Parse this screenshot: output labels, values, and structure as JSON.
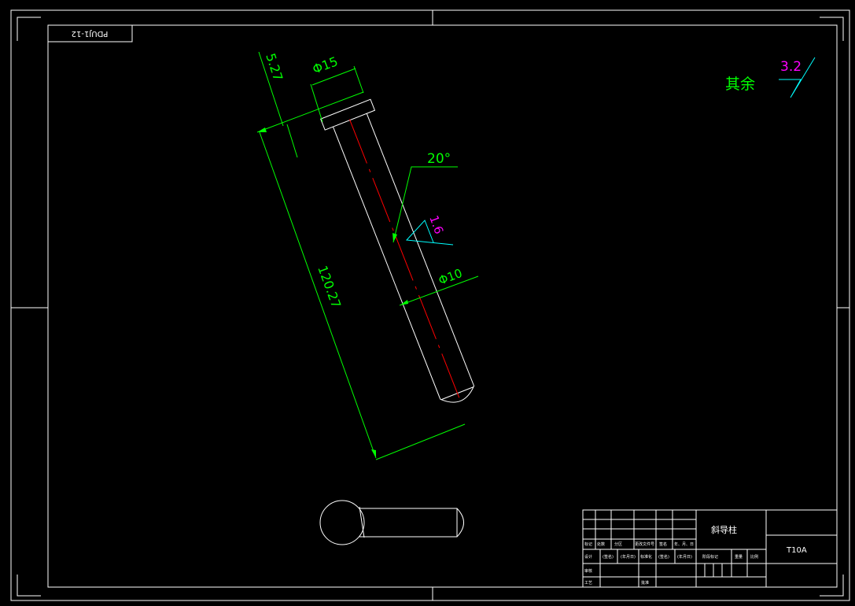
{
  "colors": {
    "background": "#000000",
    "outline": "#ffffff",
    "dimension": "#00ff00",
    "centerline": "#ff0000",
    "surface_symbol": "#00ffff",
    "roughness_value": "#ff00ff"
  },
  "drawing_number": "PDUJ1-12",
  "dimensions": {
    "head_length": "5.27",
    "head_diameter": "Φ15",
    "total_length": "120.27",
    "shaft_diameter": "Φ10",
    "tip_angle": "20°"
  },
  "surface_finish": {
    "shaft_value": "1.6",
    "general_label": "其余",
    "general_value": "3.2"
  },
  "title_block": {
    "part_name": "斜导柱",
    "material": "T10A",
    "header_labels": [
      "标记",
      "处数",
      "分区",
      "更改文件号",
      "签名",
      "年、月、日"
    ],
    "row_design": [
      "设计",
      "(签名)",
      "(年月日)",
      "标准化",
      "(签名)",
      "(年月日)"
    ],
    "row_review": "审核",
    "row_process": "工艺",
    "row_approve": "批准",
    "stage_label": "阶段标记",
    "weight_label": "重量",
    "scale_label": "比例"
  }
}
